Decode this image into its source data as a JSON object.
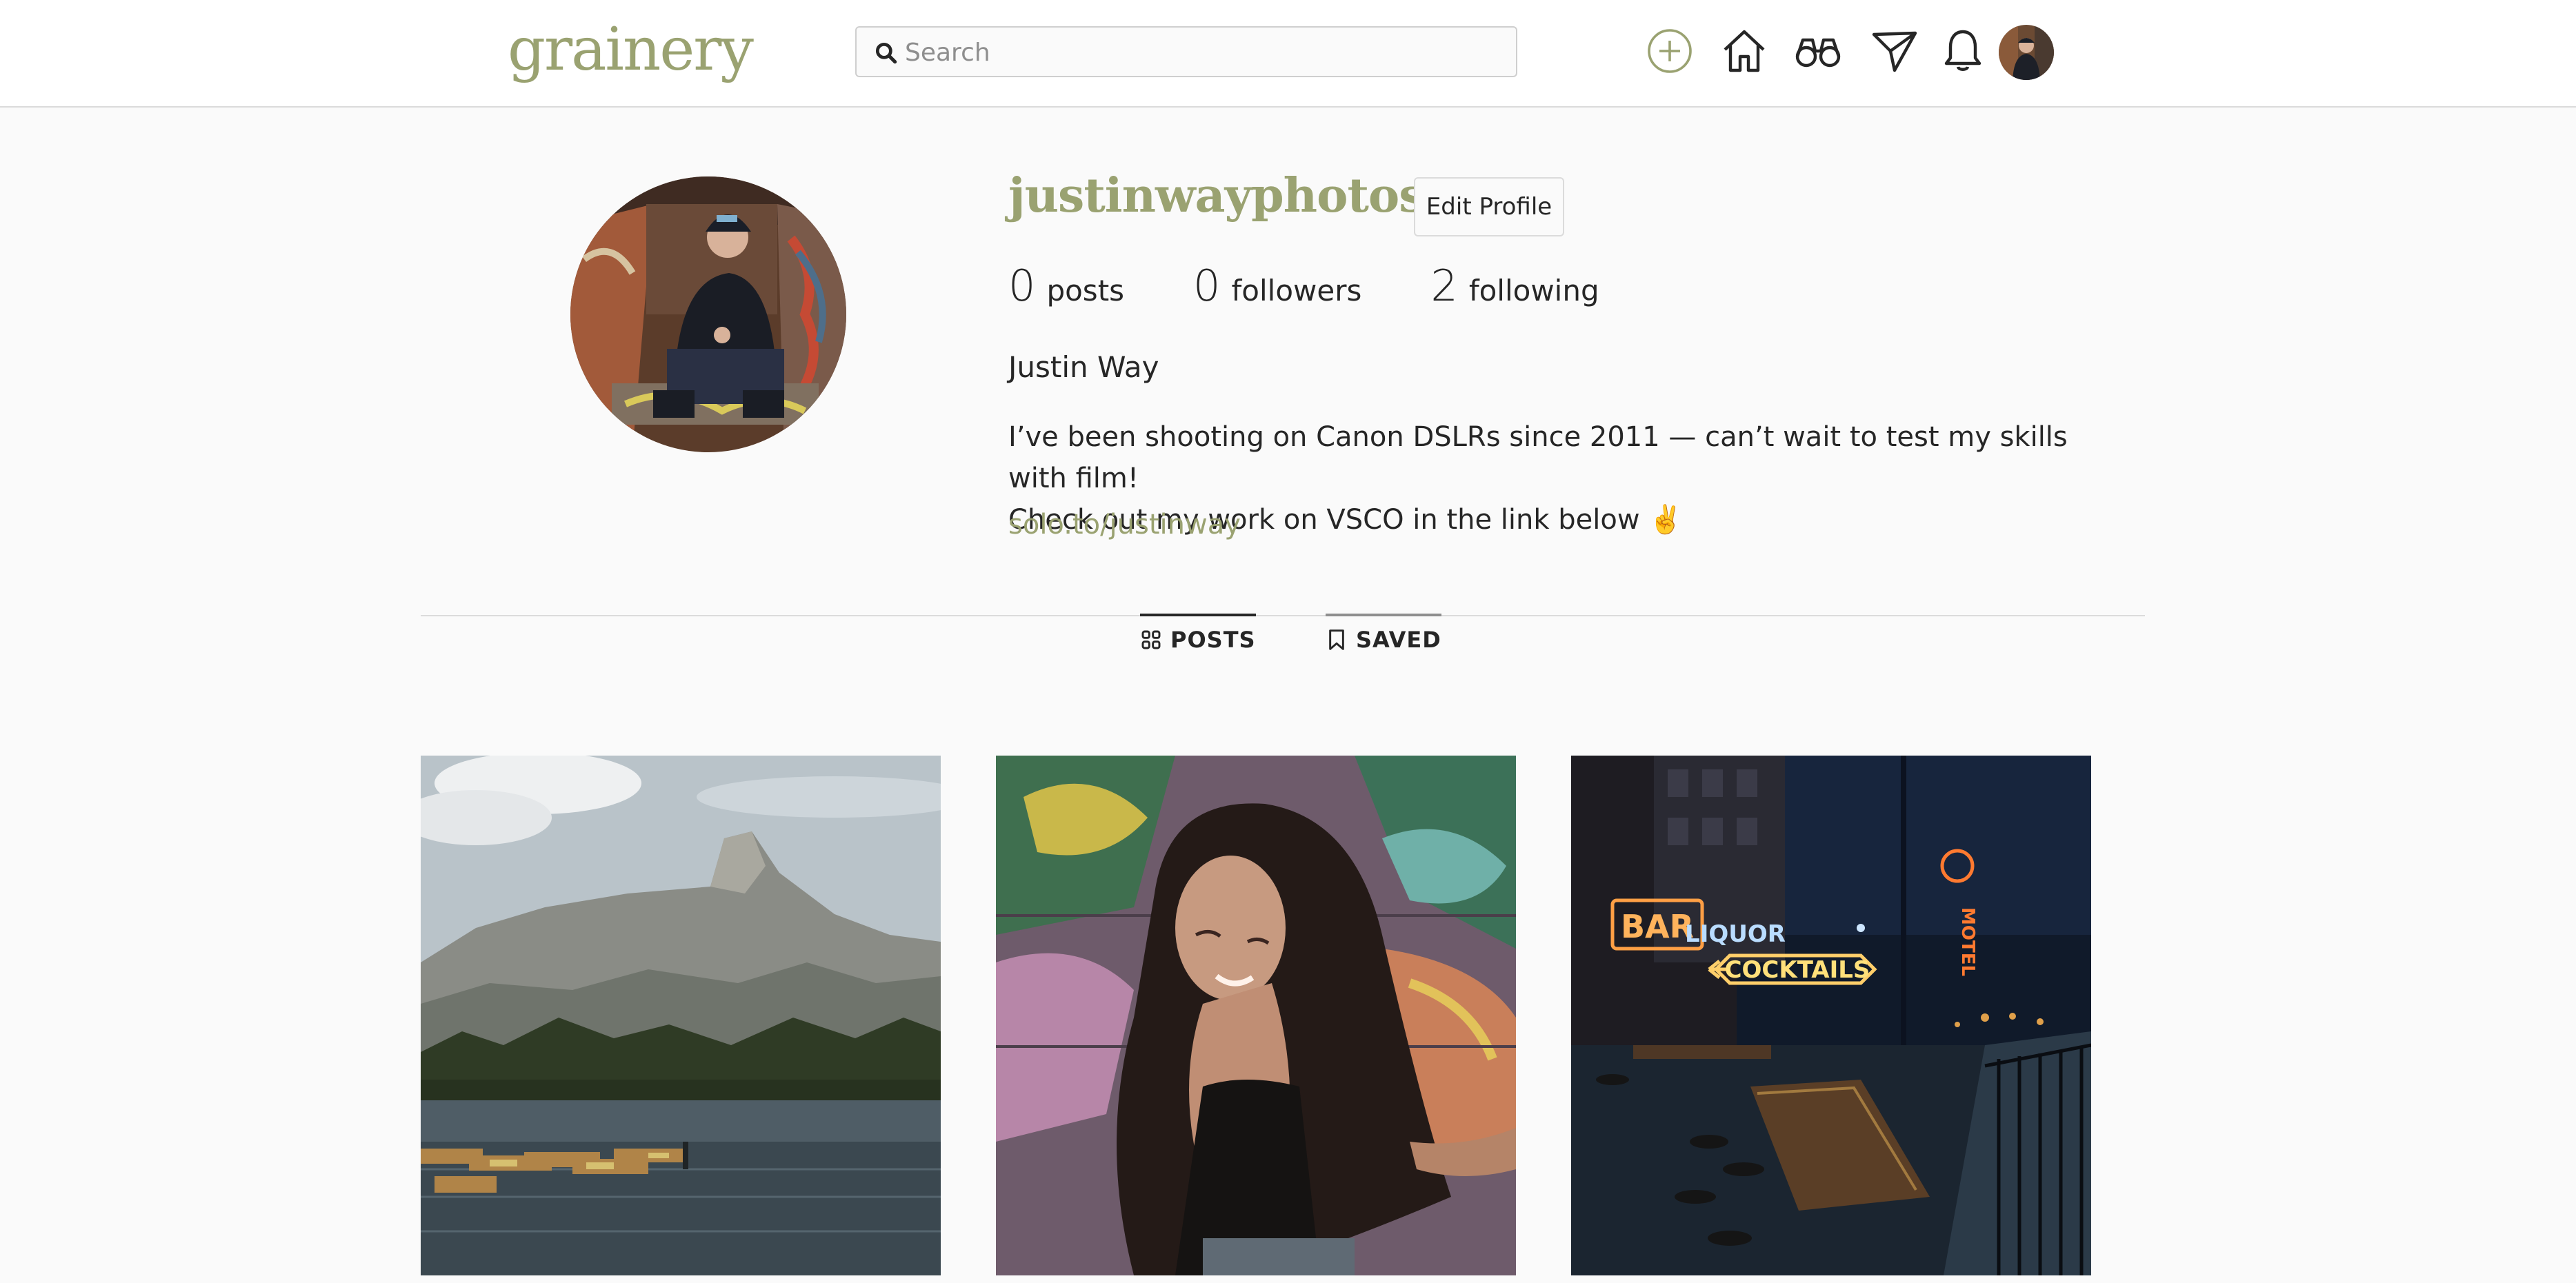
{
  "app": {
    "logo": "grainery"
  },
  "search": {
    "placeholder": "Search",
    "value": ""
  },
  "nav": {
    "icons": [
      "plus-circle-icon",
      "home-icon",
      "binoculars-icon",
      "paper-plane-icon",
      "bell-icon"
    ],
    "accent_color": "#9aa271"
  },
  "profile": {
    "username": "justinwayphotos",
    "edit_label": "Edit Profile",
    "stats": {
      "posts_count": "0",
      "posts_label": "posts",
      "followers_count": "0",
      "followers_label": "followers",
      "following_count": "2",
      "following_label": "following"
    },
    "full_name": "Justin Way",
    "bio_line1": "I’ve been shooting on Canon DSLRs since 2011 — can’t wait to test my skills with film!",
    "bio_line2": "Check out my work on VSCO in the link below ✌️",
    "link": "solo.to/justinway"
  },
  "tabs": [
    {
      "label": "POSTS",
      "icon": "grid-icon",
      "active": true
    },
    {
      "label": "SAVED",
      "icon": "bookmark-icon",
      "active": true
    }
  ],
  "posts": [
    {
      "subject": "mountain lake with boats"
    },
    {
      "subject": "woman with long hair in front of graffiti"
    },
    {
      "subject": "neon bar signs at night"
    }
  ],
  "neon": {
    "bar": "BAR",
    "liquor": "LIQUOR",
    "cocktails": "COCKTAILS",
    "motel": "MOTEL"
  }
}
